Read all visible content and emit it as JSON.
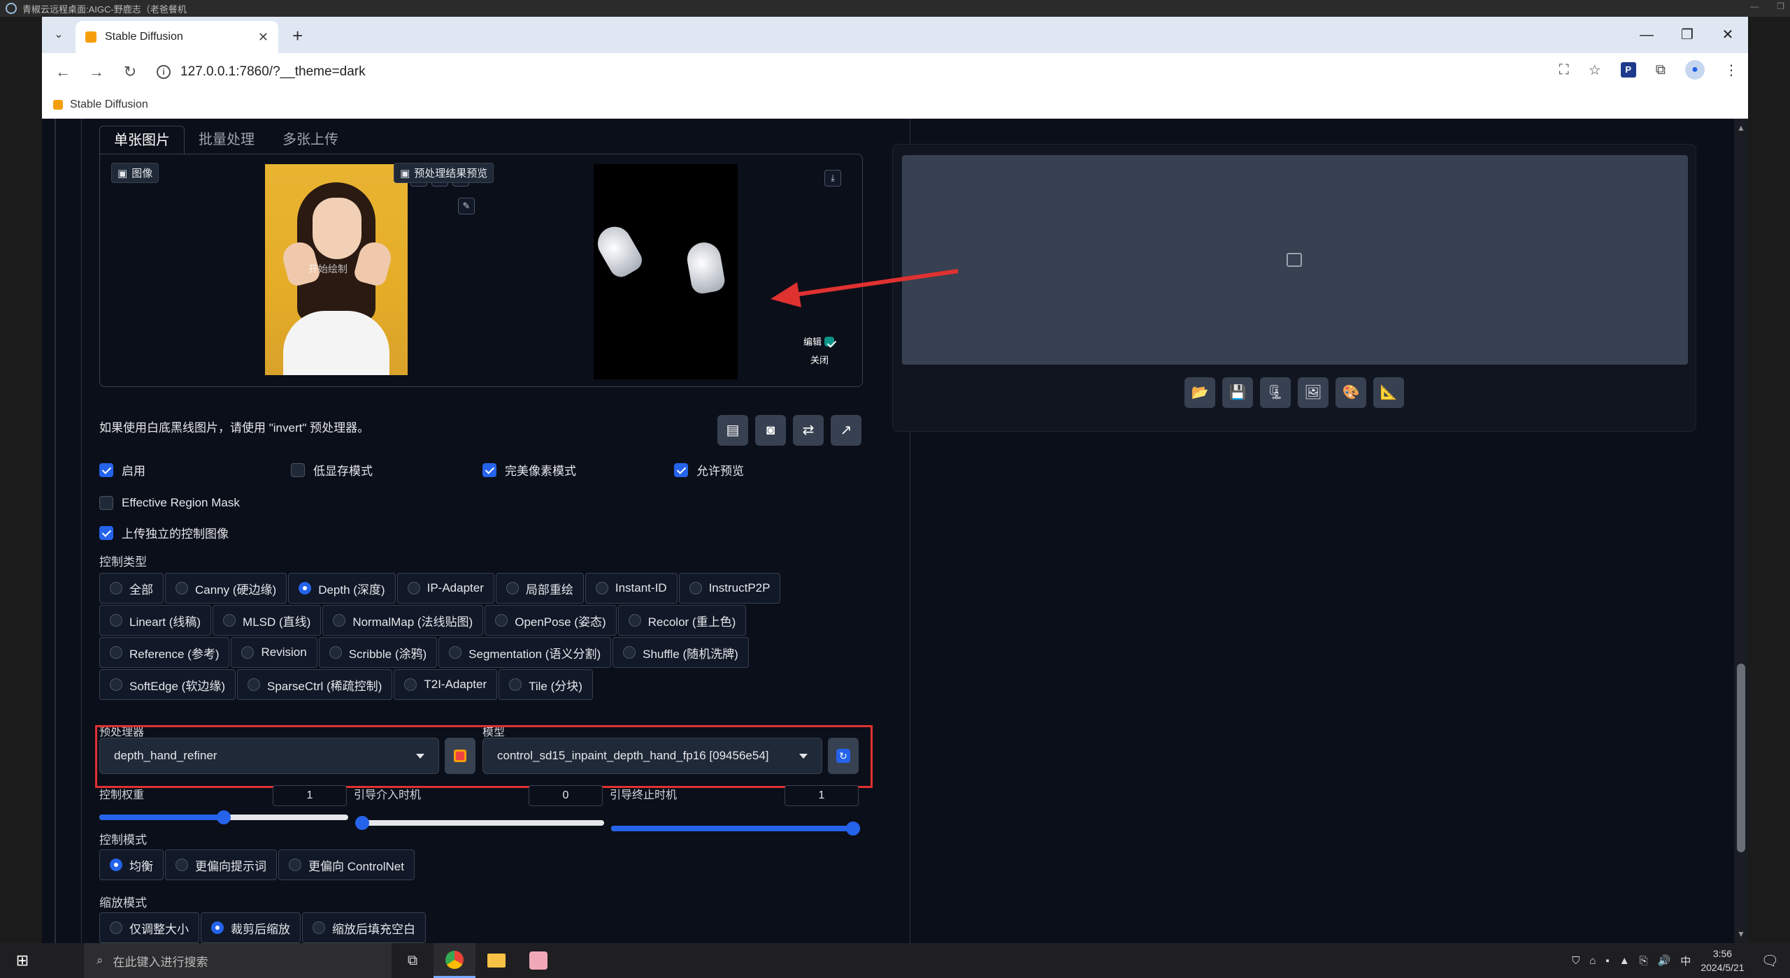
{
  "remote_bar": {
    "title": "青椒云远程桌面:AIGC-野鹿志（老爸餐机"
  },
  "browser": {
    "tab_title": "Stable Diffusion",
    "url": "127.0.0.1:7860/?__theme=dark",
    "bookmark": "Stable Diffusion",
    "window_controls": [
      "—",
      "❐",
      "✕"
    ]
  },
  "controlnet": {
    "tabs": [
      "单张图片",
      "批量处理",
      "多张上传"
    ],
    "image_label": "图像",
    "preview_label": "预处理结果预览",
    "photo_watermark": "开始绘制",
    "edit_label": "编辑",
    "close_label": "关闭",
    "hint": "如果使用白底黑线图片，请使用 \"invert\" 预处理器。",
    "checkboxes": [
      {
        "label": "启用",
        "checked": true
      },
      {
        "label": "低显存模式",
        "checked": false
      },
      {
        "label": "完美像素模式",
        "checked": true
      },
      {
        "label": "允许预览",
        "checked": true
      }
    ],
    "region_mask": {
      "label": "Effective Region Mask",
      "checked": false
    },
    "upload_independent": {
      "label": "上传独立的控制图像",
      "checked": true
    },
    "control_type_label": "控制类型",
    "control_types": [
      [
        "全部",
        "Canny (硬边缘)",
        "Depth (深度)",
        "IP-Adapter",
        "局部重绘",
        "Instant-ID",
        "InstructP2P"
      ],
      [
        "Lineart (线稿)",
        "MLSD (直线)",
        "NormalMap (法线贴图)",
        "OpenPose (姿态)",
        "Recolor (重上色)"
      ],
      [
        "Reference (参考)",
        "Revision",
        "Scribble (涂鸦)",
        "Segmentation (语义分割)",
        "Shuffle (随机洗牌)"
      ],
      [
        "SoftEdge (软边缘)",
        "SparseCtrl (稀疏控制)",
        "T2I-Adapter",
        "Tile (分块)"
      ]
    ],
    "selected_control_type": "Depth (深度)",
    "preprocessor_label": "预处理器",
    "preprocessor_value": "depth_hand_refiner",
    "model_label": "模型",
    "model_value": "control_sd15_inpaint_depth_hand_fp16 [09456e54]",
    "weight_label": "控制权重",
    "weight_value": "1",
    "start_label": "引导介入时机",
    "start_value": "0",
    "end_label": "引导终止时机",
    "end_value": "1",
    "slider_levels": {
      "weight": 0.5,
      "start": 0.0,
      "end": 1.0
    },
    "control_mode_label": "控制模式",
    "control_modes": [
      "均衡",
      "更偏向提示词",
      "更偏向 ControlNet"
    ],
    "selected_control_mode": "均衡",
    "resize_mode_label": "缩放模式",
    "resize_modes": [
      "仅调整大小",
      "裁剪后缩放",
      "缩放后填充空白"
    ],
    "selected_resize_mode": "裁剪后缩放"
  },
  "taskbar": {
    "search_placeholder": "在此键入进行搜索",
    "ime": "中",
    "time": "3:56",
    "date": "2024/5/21"
  },
  "colors": {
    "accent": "#2563eb",
    "highlight_box": "#e03131",
    "arrow": "#e03131"
  }
}
